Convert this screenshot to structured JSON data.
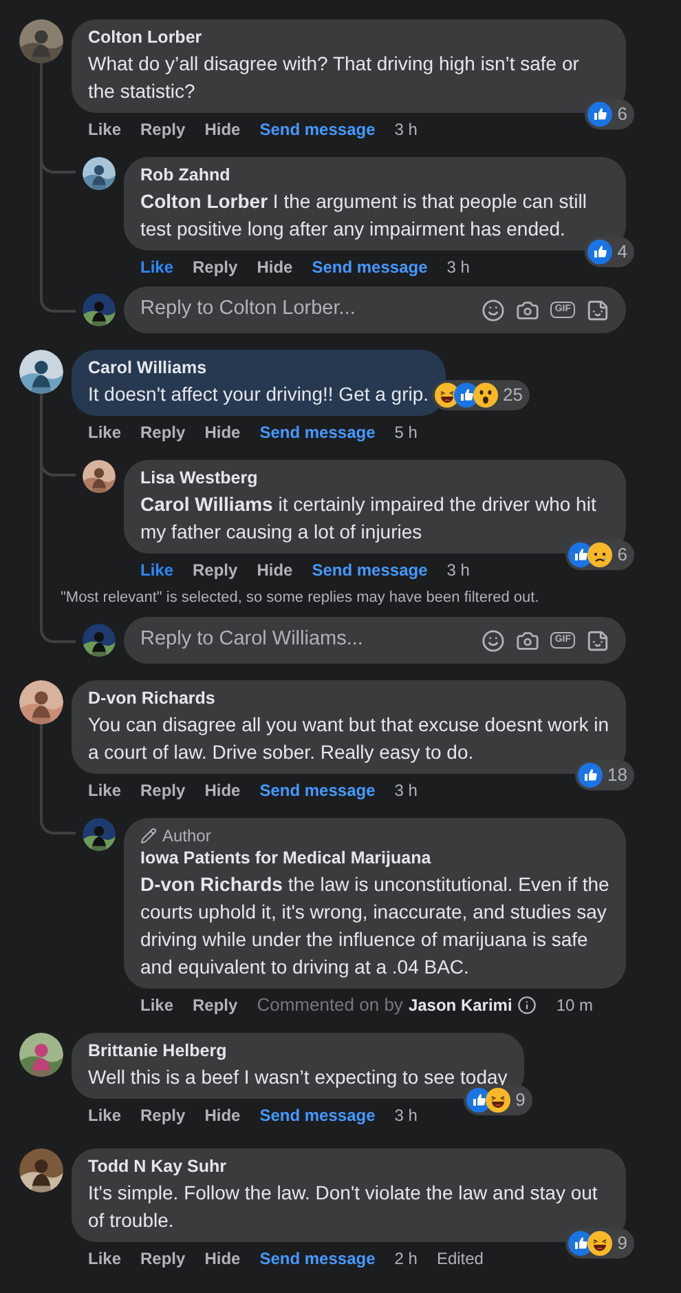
{
  "comments": [
    {
      "author": "Colton Lorber",
      "text": "What do y’all disagree with? That driving high isn’t safe or the statistic?",
      "highlighted": false,
      "liked": false,
      "reactions": [
        {
          "kind": "like"
        }
      ],
      "reaction_count": "6",
      "actions": [
        {
          "label": "Like",
          "kind": "like"
        },
        {
          "label": "Reply",
          "kind": "plain"
        },
        {
          "label": "Hide",
          "kind": "plain"
        },
        {
          "label": "Send message",
          "kind": "link"
        }
      ],
      "time": "3 h",
      "replies": [
        {
          "author": "Rob Zahnd",
          "text": "**Colton Lorber** I the argument is that people can still test positive long after any impairment has ended.",
          "liked": true,
          "reactions": [
            {
              "kind": "like"
            }
          ],
          "reaction_count": "4",
          "actions": [
            {
              "label": "Like",
              "kind": "like"
            },
            {
              "label": "Reply",
              "kind": "plain"
            },
            {
              "label": "Hide",
              "kind": "plain"
            },
            {
              "label": "Send message",
              "kind": "link"
            }
          ],
          "time": "3 h"
        }
      ],
      "reply_box": {
        "placeholder": "Reply to Colton Lorber...",
        "gif_label": "GIF"
      }
    },
    {
      "author": "Carol Williams",
      "text": "It doesn't affect your driving!! Get a grip.",
      "highlighted": true,
      "liked": false,
      "reactions": [
        {
          "kind": "haha"
        },
        {
          "kind": "like"
        },
        {
          "kind": "wow"
        }
      ],
      "reaction_count": "25",
      "actions": [
        {
          "label": "Like",
          "kind": "like"
        },
        {
          "label": "Reply",
          "kind": "plain"
        },
        {
          "label": "Hide",
          "kind": "plain"
        },
        {
          "label": "Send message",
          "kind": "link"
        }
      ],
      "time": "5 h",
      "replies": [
        {
          "author": "Lisa Westberg",
          "text": "**Carol Williams** it certainly impaired the driver who hit my father causing a lot of injuries",
          "liked": true,
          "reactions": [
            {
              "kind": "like"
            },
            {
              "kind": "sad"
            }
          ],
          "reaction_count": "6",
          "actions": [
            {
              "label": "Like",
              "kind": "like"
            },
            {
              "label": "Reply",
              "kind": "plain"
            },
            {
              "label": "Hide",
              "kind": "plain"
            },
            {
              "label": "Send message",
              "kind": "link"
            }
          ],
          "time": "3 h"
        }
      ],
      "note": "\"Most relevant\" is selected, so some replies may have been filtered out.",
      "reply_box": {
        "placeholder": "Reply to Carol Williams...",
        "gif_label": "GIF"
      }
    },
    {
      "author": "D-von Richards",
      "text": "You can disagree all you want but that excuse doesnt work in a court of law. Drive sober. Really easy to do.",
      "highlighted": false,
      "liked": false,
      "reactions": [
        {
          "kind": "like"
        }
      ],
      "reaction_count": "18",
      "actions": [
        {
          "label": "Like",
          "kind": "like"
        },
        {
          "label": "Reply",
          "kind": "plain"
        },
        {
          "label": "Hide",
          "kind": "plain"
        },
        {
          "label": "Send message",
          "kind": "link"
        }
      ],
      "time": "3 h",
      "replies": [
        {
          "author": "Iowa Patients for Medical Marijuana",
          "badge": "Author",
          "text": "**D-von Richards** the law is unconstitutional. Even if the courts uphold it, it's wrong, inaccurate, and studies say driving while under the influence of marijuana is safe and equivalent to driving at a .04 BAC.",
          "liked": false,
          "actions": [
            {
              "label": "Like",
              "kind": "like"
            },
            {
              "label": "Reply",
              "kind": "plain"
            }
          ],
          "commented_by": {
            "prefix": "Commented on by",
            "name": "Jason Karimi"
          },
          "time": "10 m"
        }
      ]
    },
    {
      "author": "Brittanie Helberg",
      "text": "Well this is a beef I wasn’t expecting to see today",
      "highlighted": false,
      "liked": false,
      "reactions": [
        {
          "kind": "like"
        },
        {
          "kind": "haha"
        }
      ],
      "reaction_count": "9",
      "actions": [
        {
          "label": "Like",
          "kind": "like"
        },
        {
          "label": "Reply",
          "kind": "plain"
        },
        {
          "label": "Hide",
          "kind": "plain"
        },
        {
          "label": "Send message",
          "kind": "link"
        }
      ],
      "time": "3 h"
    },
    {
      "author": "Todd N Kay Suhr",
      "text": "It's simple. Follow the law. Don't violate the law and stay out of trouble.",
      "highlighted": false,
      "liked": false,
      "reactions": [
        {
          "kind": "like"
        },
        {
          "kind": "haha"
        }
      ],
      "reaction_count": "9",
      "actions": [
        {
          "label": "Like",
          "kind": "like"
        },
        {
          "label": "Reply",
          "kind": "plain"
        },
        {
          "label": "Hide",
          "kind": "plain"
        },
        {
          "label": "Send message",
          "kind": "link"
        }
      ],
      "time": "2 h",
      "edited": "Edited"
    }
  ]
}
